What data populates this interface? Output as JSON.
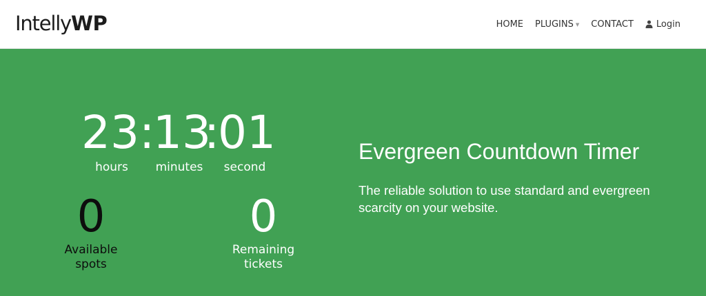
{
  "header": {
    "logo_light": "Intelly",
    "logo_bold": "WP",
    "nav": {
      "home": "HOME",
      "plugins": "PLUGINS",
      "contact": "CONTACT",
      "login": "Login"
    },
    "icons": {
      "plugins_caret": "chevron-down-icon",
      "login_icon": "user-icon"
    }
  },
  "hero": {
    "background_color": "#41a154",
    "timer": {
      "hours": "23",
      "minutes": "13",
      "seconds": "01",
      "separator": ":",
      "hours_label": "hours",
      "minutes_label": "minutes",
      "seconds_label": "second"
    },
    "counters": {
      "spots_value": "0",
      "spots_label_line1": "Available",
      "spots_label_line2": "spots",
      "tickets_value": "0",
      "tickets_label_line1": "Remaining",
      "tickets_label_line2": "tickets"
    },
    "title": "Evergreen Countdown Timer",
    "description": "The reliable solution to use standard and evergreen scarcity on your website."
  }
}
